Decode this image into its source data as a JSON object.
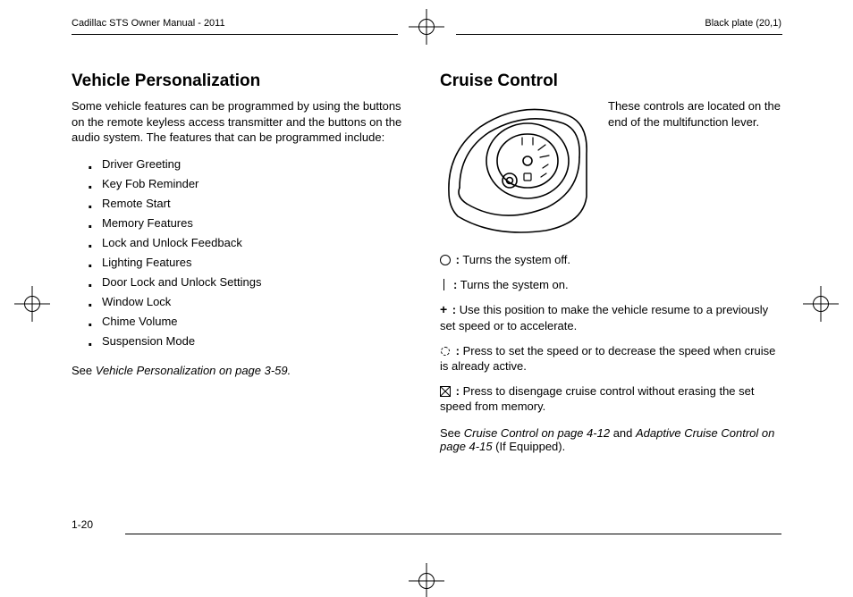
{
  "header": {
    "left": "Cadillac STS Owner Manual - 2011",
    "right": "Black plate (20,1)"
  },
  "page_number": "1-20",
  "left_col": {
    "heading": "Vehicle Personalization",
    "intro": "Some vehicle features can be programmed by using the buttons on the remote keyless access transmitter and the buttons on the audio system. The features that can be programmed include:",
    "items": [
      "Driver Greeting",
      "Key Fob Reminder",
      "Remote Start",
      "Memory Features",
      "Lock and Unlock Feedback",
      "Lighting Features",
      "Door Lock and Unlock Settings",
      "Window Lock",
      "Chime Volume",
      "Suspension Mode"
    ],
    "see_prefix": "See ",
    "see_ref": "Vehicle Personalization on page 3-59.",
    "see_suffix": ""
  },
  "right_col": {
    "heading": "Cruise Control",
    "note": "These controls are located on the end of the multifunction lever.",
    "defs": {
      "off": {
        "text": "Turns the system off."
      },
      "on": {
        "text": "Turns the system on."
      },
      "plus": {
        "sym": "+",
        "text": "Use this position to make the vehicle resume to a previously set speed or to accelerate."
      },
      "set": {
        "text": "Press to set the speed or to decrease the speed when cruise is already active."
      },
      "cancel": {
        "text": "Press to disengage cruise control without erasing the set speed from memory."
      }
    },
    "see_prefix": "See ",
    "see_ref1": "Cruise Control on page 4-12",
    "see_mid": " and ",
    "see_ref2": "Adaptive Cruise Control on page 4-15",
    "see_suffix": " (If Equipped)."
  }
}
